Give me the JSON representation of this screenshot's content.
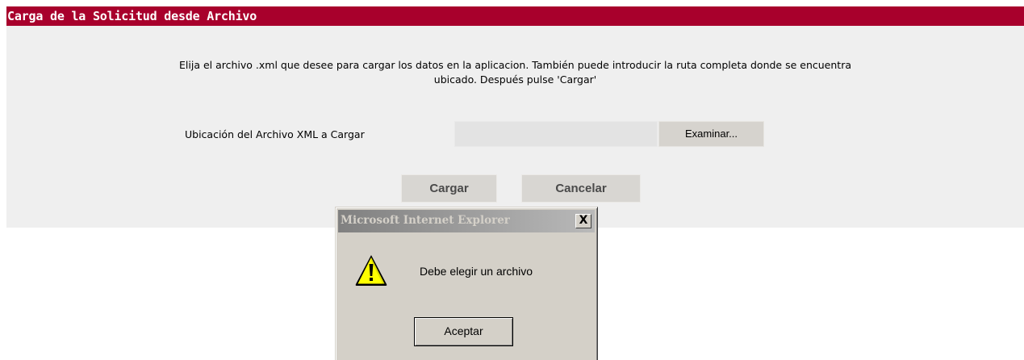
{
  "page": {
    "title": "Carga de la Solicitud desde Archivo",
    "instructions": "Elija el archivo .xml que desee para cargar los datos en la aplicacion. También puede introducir la ruta completa donde se encuentra\nubicado. Después pulse 'Cargar'",
    "file_label": "Ubicación del Archivo XML a Cargar",
    "file_value": "",
    "browse_label": "Examinar...",
    "submit_label": "Cargar",
    "cancel_label": "Cancelar"
  },
  "dialog": {
    "title": "Microsoft Internet Explorer",
    "close_label": "X",
    "message": "Debe elegir un archivo",
    "ok_label": "Aceptar",
    "icon": "warning-icon"
  },
  "colors": {
    "title_bar": "#a8002c",
    "panel_background": "#efefef",
    "dialog_background": "#d4d0c8"
  }
}
